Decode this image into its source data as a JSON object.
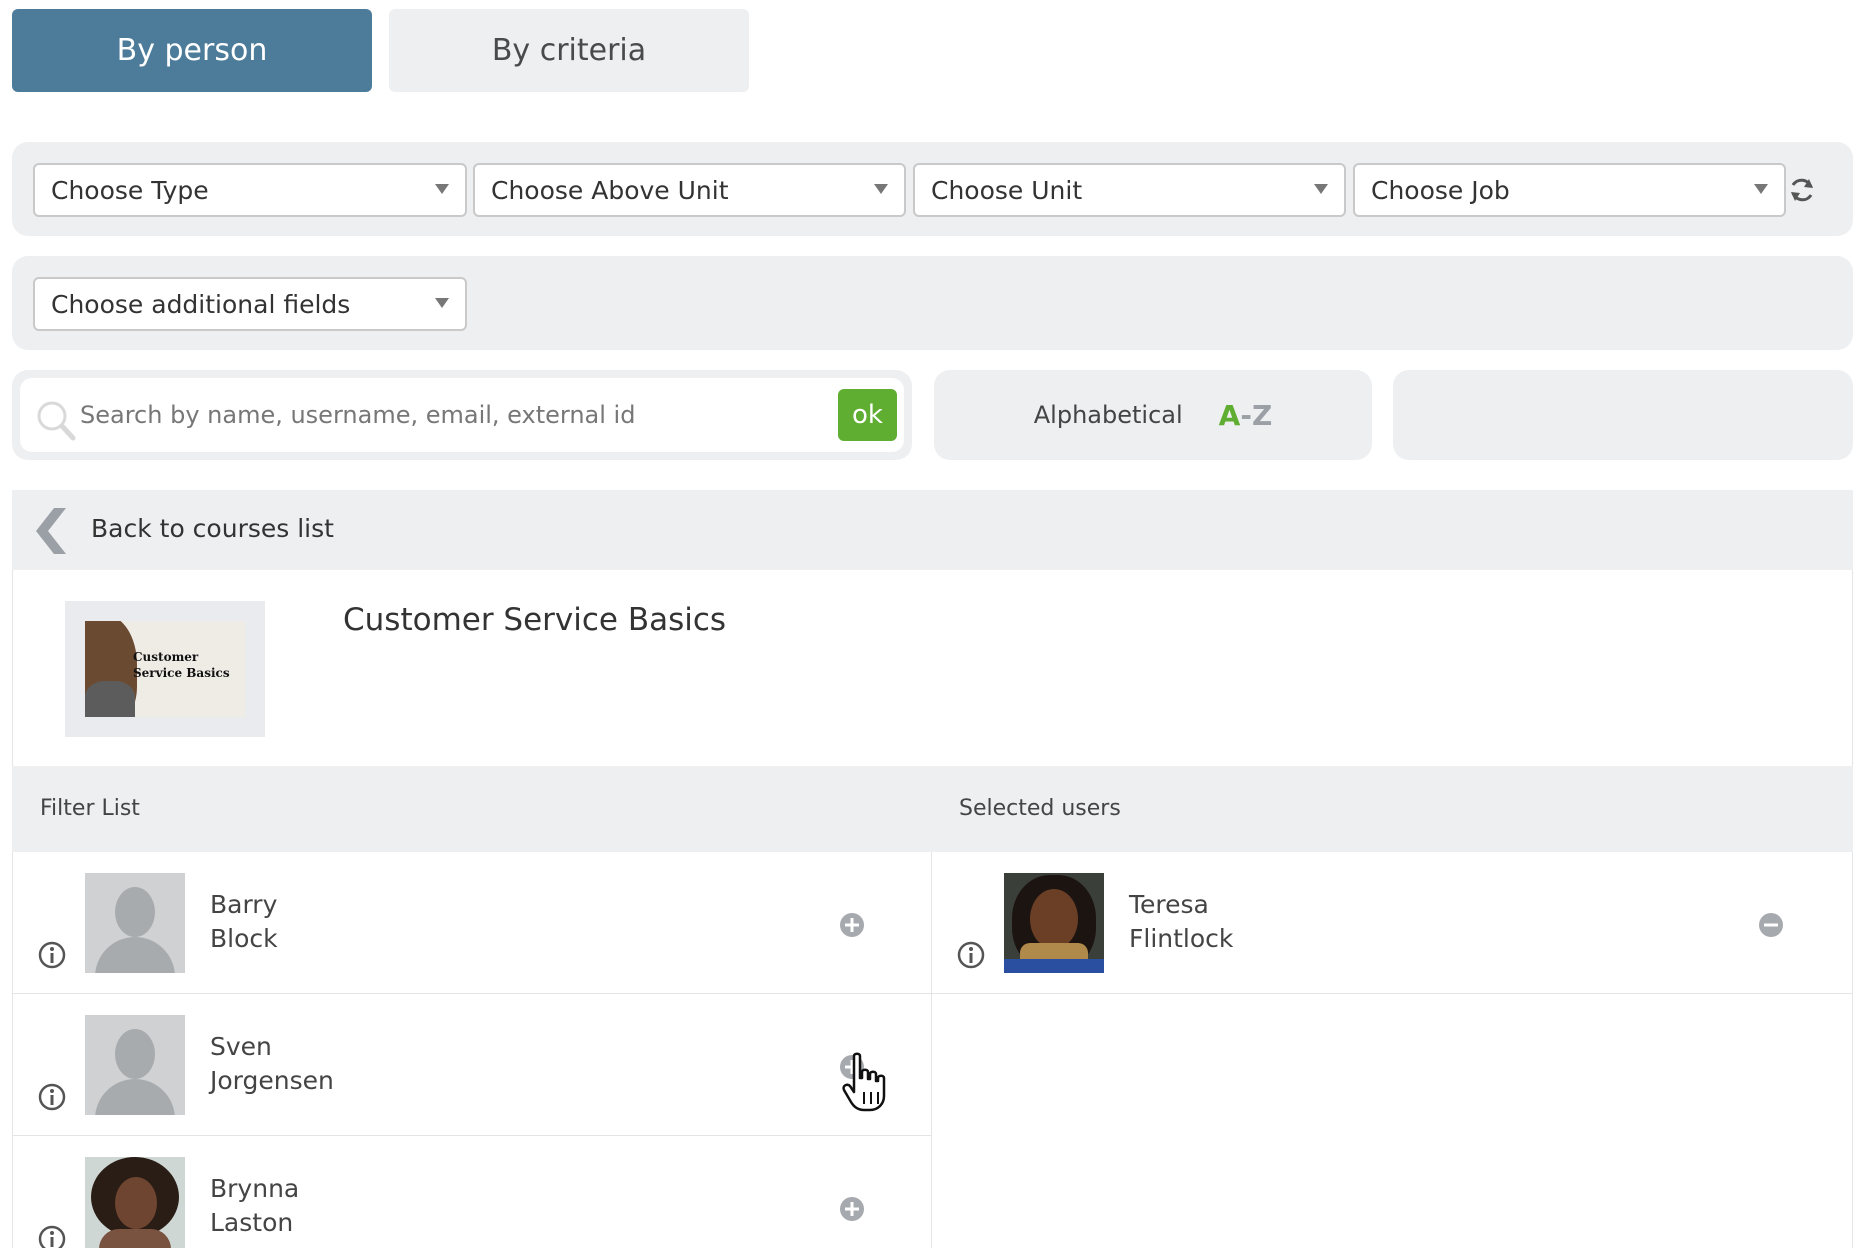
{
  "tabs": {
    "by_person": "By person",
    "by_criteria": "By criteria"
  },
  "filters": {
    "type": "Choose Type",
    "above_unit": "Choose Above Unit",
    "unit": "Choose Unit",
    "job": "Choose Job",
    "additional_fields": "Choose additional fields"
  },
  "search": {
    "placeholder": "Search by name, username, email, external id",
    "ok_label": "ok"
  },
  "sort": {
    "label": "Alphabetical",
    "az_a": "A",
    "az_dash": "-",
    "az_z": "Z"
  },
  "back": {
    "label": "Back to courses list"
  },
  "course": {
    "title": "Customer Service Basics",
    "thumbnail_text": "Customer Service Basics"
  },
  "lists": {
    "filter_header": "Filter List",
    "selected_header": "Selected users",
    "filter_users": [
      {
        "first": "Barry",
        "last": "Block"
      },
      {
        "first": "Sven",
        "last": "Jorgensen"
      },
      {
        "first": "Brynna",
        "last": "Laston"
      }
    ],
    "selected_users": [
      {
        "first": "Teresa",
        "last": "Flintlock"
      }
    ]
  },
  "colors": {
    "active_tab": "#4c7c99",
    "ok_green": "#5fae32",
    "panel_gray": "#eeeff1"
  }
}
